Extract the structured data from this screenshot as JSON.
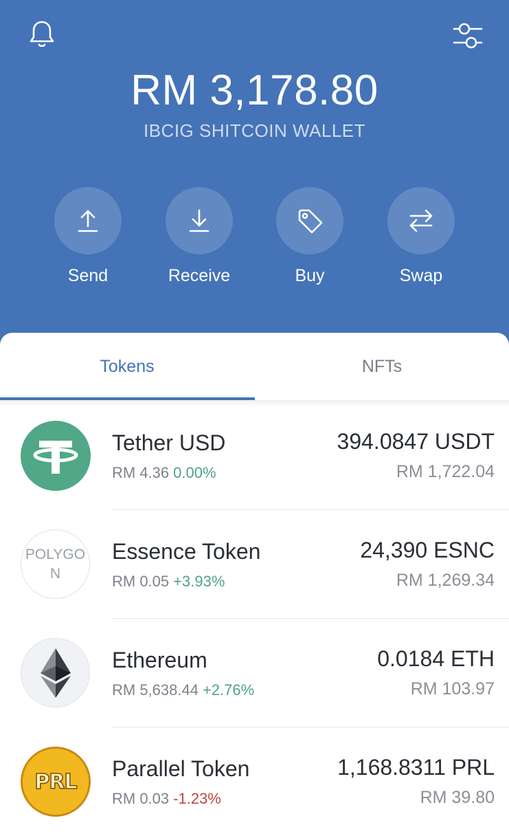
{
  "header": {
    "balance": "RM 3,178.80",
    "wallet_name": "IBCIG SHITCOIN WALLET",
    "bell_icon": "bell-icon",
    "settings_icon": "sliders-icon"
  },
  "actions": [
    {
      "label": "Send",
      "icon": "upload-arrow-icon"
    },
    {
      "label": "Receive",
      "icon": "download-arrow-icon"
    },
    {
      "label": "Buy",
      "icon": "tag-icon"
    },
    {
      "label": "Swap",
      "icon": "swap-arrows-icon"
    }
  ],
  "tabs": [
    {
      "label": "Tokens",
      "active": true
    },
    {
      "label": "NFTs",
      "active": false
    }
  ],
  "tokens": [
    {
      "name": "Tether USD",
      "price": "RM 4.36",
      "change": "0.00%",
      "balance": "394.0847 USDT",
      "fiat": "RM 1,722.04",
      "logo": "tether-logo-icon"
    },
    {
      "name": "Essence Token",
      "price": "RM 0.05",
      "change": "+3.93%",
      "balance": "24,390 ESNC",
      "fiat": "RM 1,269.34",
      "logo_text": "POLYGON"
    },
    {
      "name": "Ethereum",
      "price": "RM 5,638.44",
      "change": "+2.76%",
      "balance": "0.0184 ETH",
      "fiat": "RM 103.97",
      "logo": "ethereum-logo-icon"
    },
    {
      "name": "Parallel Token",
      "price": "RM 0.03",
      "change": "-1.23%",
      "balance": "1,168.8311 PRL",
      "fiat": "RM 39.80",
      "logo_text": "PRL"
    }
  ],
  "colors": {
    "header_bg": "#4473b7",
    "accent": "#4473b7",
    "positive": "#4fa383",
    "negative": "#c24646",
    "tether_green": "#50a887"
  }
}
